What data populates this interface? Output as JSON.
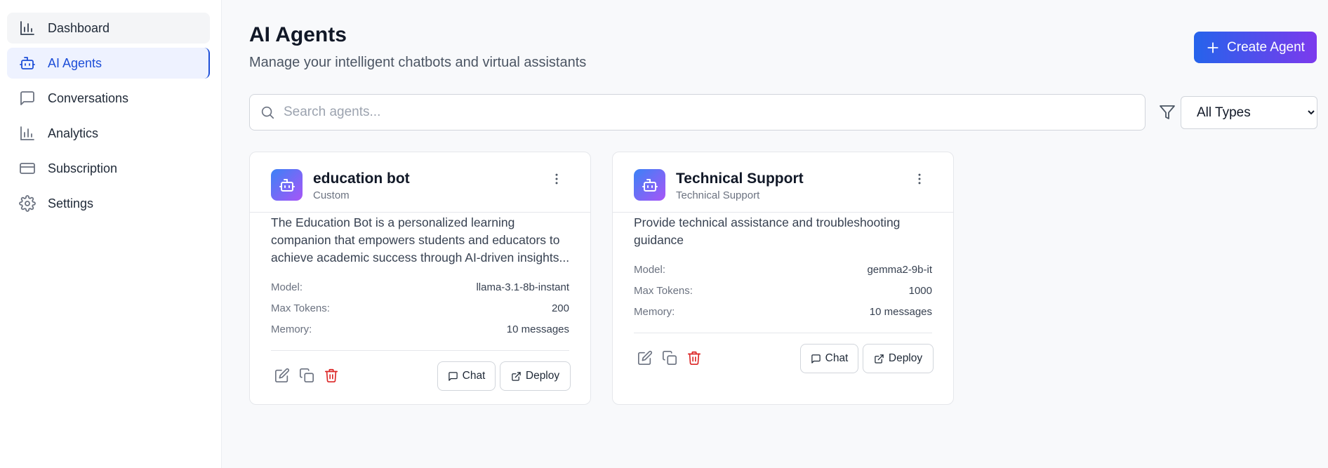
{
  "sidebar": {
    "items": [
      {
        "label": "Dashboard",
        "icon": "bar-chart-icon"
      },
      {
        "label": "AI Agents",
        "icon": "bot-icon"
      },
      {
        "label": "Conversations",
        "icon": "chat-bubble-icon"
      },
      {
        "label": "Analytics",
        "icon": "bar-chart-icon"
      },
      {
        "label": "Subscription",
        "icon": "credit-card-icon"
      },
      {
        "label": "Settings",
        "icon": "gear-icon"
      }
    ]
  },
  "header": {
    "title": "AI Agents",
    "subtitle": "Manage your intelligent chatbots and virtual assistants",
    "create_label": "Create Agent"
  },
  "search": {
    "placeholder": "Search agents...",
    "value": ""
  },
  "filter": {
    "selected": "All Types"
  },
  "labels": {
    "model": "Model:",
    "max_tokens": "Max Tokens:",
    "memory": "Memory:",
    "chat": "Chat",
    "deploy": "Deploy"
  },
  "agents": [
    {
      "name": "education bot",
      "type": "Custom",
      "description": "The Education Bot is a personalized learning companion that empowers students and educators to achieve academic success through AI-driven insights...",
      "model": "llama-3.1-8b-instant",
      "max_tokens": "200",
      "memory": "10 messages"
    },
    {
      "name": "Technical Support",
      "type": "Technical Support",
      "description": "Provide technical assistance and troubleshooting guidance",
      "model": "gemma2-9b-it",
      "max_tokens": "1000",
      "memory": "10 messages"
    }
  ],
  "colors": {
    "accent": "#1d4ed8",
    "gradient_start": "#2563eb",
    "gradient_end": "#7c3aed",
    "delete": "#dc2626"
  }
}
